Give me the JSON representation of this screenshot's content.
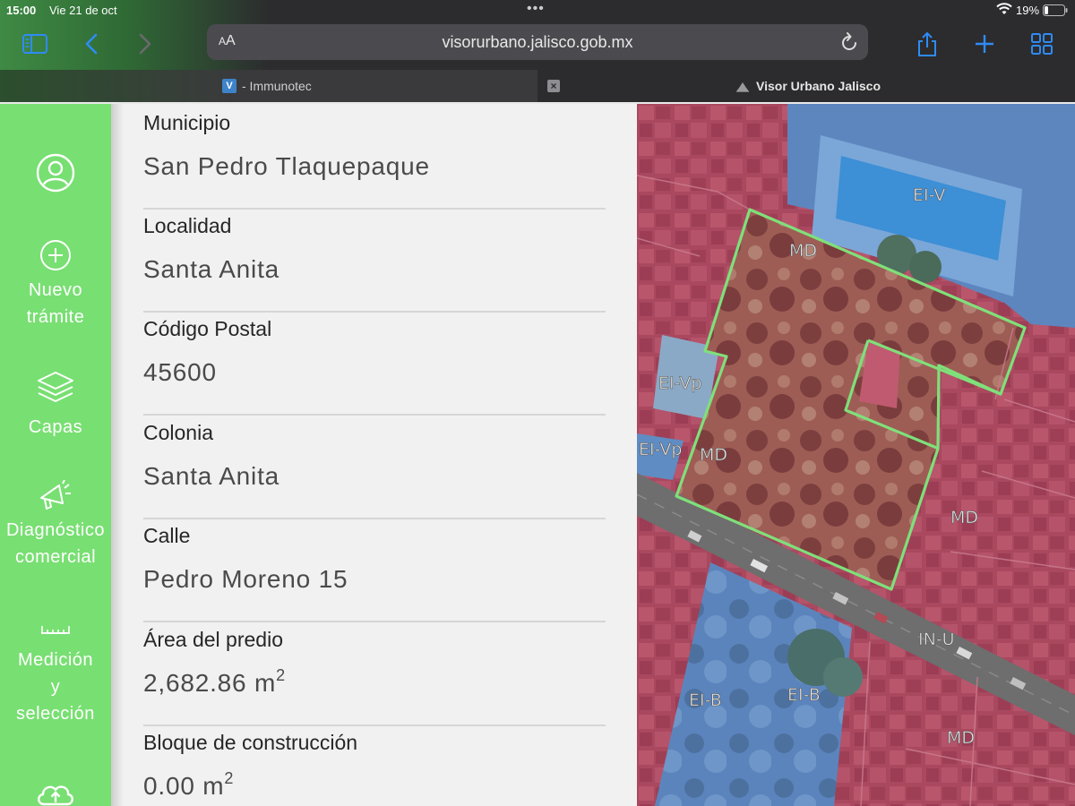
{
  "status_bar": {
    "time": "15:00",
    "date": "Vie 21 de oct",
    "battery_percent": "19%",
    "battery_level": 0.19
  },
  "browser": {
    "text_size_label": "AA",
    "url": "visorurbano.jalisco.gob.mx",
    "accent_color": "#2f8bf5",
    "icons": [
      "sidebar-icon",
      "back-icon",
      "forward-icon",
      "reload-icon",
      "share-icon",
      "new-tab-icon",
      "tabs-overview-icon"
    ],
    "tabs": [
      {
        "title": "- Immunotec",
        "active": false
      },
      {
        "title": "Visor Urbano Jalisco",
        "active": true
      }
    ]
  },
  "sidebar": {
    "background": "#78df72",
    "items": [
      {
        "icon": "user-icon",
        "label": ""
      },
      {
        "icon": "plus-circle-icon",
        "label_lines": [
          "Nuevo",
          "trámite"
        ]
      },
      {
        "icon": "layers-icon",
        "label_lines": [
          "Capas"
        ]
      },
      {
        "icon": "megaphone-icon",
        "label_lines": [
          "Diagnóstico",
          "comercial"
        ]
      },
      {
        "icon": "ruler-icon",
        "label_lines": [
          "Medición",
          "y",
          "selección"
        ]
      },
      {
        "icon": "cloud-upload-icon",
        "label": ""
      }
    ]
  },
  "predio": {
    "fields": [
      {
        "label": "Municipio",
        "value": "San Pedro Tlaquepaque",
        "sup": ""
      },
      {
        "label": "Localidad",
        "value": "Santa Anita",
        "sup": ""
      },
      {
        "label": "Código Postal",
        "value": "45600",
        "sup": ""
      },
      {
        "label": "Colonia",
        "value": "Santa Anita",
        "sup": ""
      },
      {
        "label": "Calle",
        "value": "Pedro Moreno 15",
        "sup": ""
      },
      {
        "label": "Área del predio",
        "value": "2,682.86 m",
        "sup": "2"
      },
      {
        "label": "Bloque de construcción",
        "value": "0.00 m",
        "sup": "2"
      }
    ]
  },
  "map": {
    "colors": {
      "residential": "#b04a64",
      "equipment": "#5a86c0",
      "outline": "#7fe07a",
      "road": "#6e6e6e"
    },
    "zone_labels": [
      "EI-V",
      "MD",
      "EI-Vp",
      "EI-Vp",
      "MD",
      "MD",
      "IN-U",
      "EI-B",
      "EI-B",
      "MD"
    ]
  }
}
